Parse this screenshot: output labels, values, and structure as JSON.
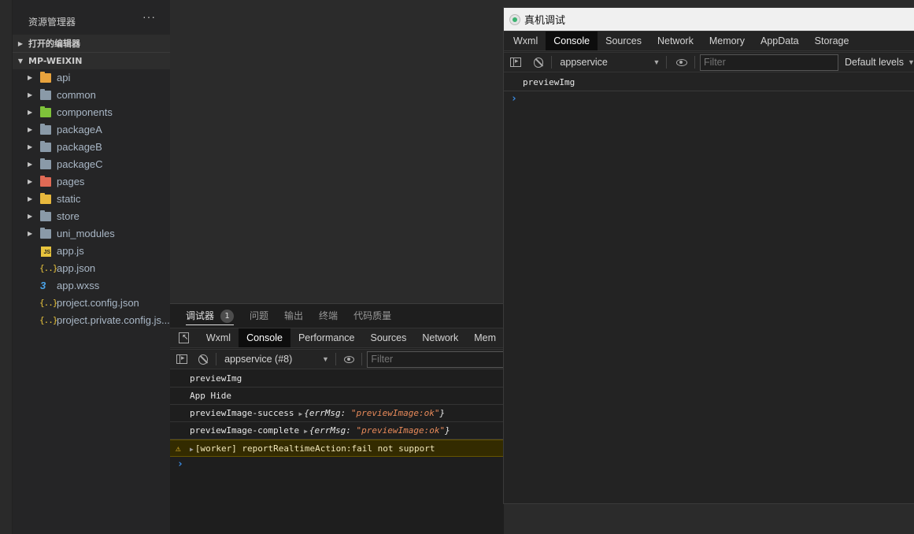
{
  "explorer": {
    "title": "资源管理器",
    "more": "···",
    "open_editors": "打开的编辑器",
    "project": "MP-WEIXIN",
    "items": [
      {
        "label": "api",
        "type": "folder",
        "icon": "folder-api-icon"
      },
      {
        "label": "common",
        "type": "folder",
        "icon": "folder-icon"
      },
      {
        "label": "components",
        "type": "folder",
        "icon": "folder-components-icon"
      },
      {
        "label": "packageA",
        "type": "folder",
        "icon": "folder-icon"
      },
      {
        "label": "packageB",
        "type": "folder",
        "icon": "folder-icon"
      },
      {
        "label": "packageC",
        "type": "folder",
        "icon": "folder-icon"
      },
      {
        "label": "pages",
        "type": "folder",
        "icon": "folder-pages-icon"
      },
      {
        "label": "static",
        "type": "folder",
        "icon": "folder-static-icon"
      },
      {
        "label": "store",
        "type": "folder",
        "icon": "folder-icon"
      },
      {
        "label": "uni_modules",
        "type": "folder",
        "icon": "folder-icon"
      },
      {
        "label": "app.js",
        "type": "file",
        "icon": "js-file-icon"
      },
      {
        "label": "app.json",
        "type": "file",
        "icon": "json-file-icon"
      },
      {
        "label": "app.wxss",
        "type": "file",
        "icon": "css-file-icon"
      },
      {
        "label": "project.config.json",
        "type": "file",
        "icon": "json-file-icon"
      },
      {
        "label": "project.private.config.js...",
        "type": "file",
        "icon": "json-file-icon"
      }
    ],
    "json_glyph": "{..}",
    "js_glyph": "JS",
    "css_glyph": "3"
  },
  "panel": {
    "tabs": [
      {
        "label": "调试器",
        "active": true
      },
      {
        "label": "问题"
      },
      {
        "label": "输出"
      },
      {
        "label": "终端"
      },
      {
        "label": "代码质量"
      }
    ],
    "badge": "1",
    "devtools_tabs": [
      "Wxml",
      "Console",
      "Performance",
      "Sources",
      "Network",
      "Mem"
    ],
    "active_tab": "Console",
    "context": "appservice (#8)",
    "filter_placeholder": "Filter",
    "console": [
      {
        "text": "previewImg"
      },
      {
        "text": "App Hide"
      },
      {
        "text": "previewImage-success",
        "obj_open": "{errMsg: ",
        "str": "\"previewImage:ok\"",
        "obj_close": "}"
      },
      {
        "text": "previewImage-complete",
        "obj_open": "{errMsg: ",
        "str": "\"previewImage:ok\"",
        "obj_close": "}"
      },
      {
        "text": "[worker] reportRealtimeAction:fail not support",
        "level": "warning"
      }
    ],
    "prompt": "›"
  },
  "remote": {
    "title": "真机调试",
    "devtools_tabs": [
      "Wxml",
      "Console",
      "Sources",
      "Network",
      "Memory",
      "AppData",
      "Storage"
    ],
    "active_tab": "Console",
    "context": "appservice",
    "filter_placeholder": "Filter",
    "levels": "Default levels",
    "console": [
      {
        "text": "previewImg"
      }
    ],
    "prompt": "›"
  },
  "colors": {
    "accent_prompt": "#3a8ee6",
    "warning_bg": "#332b00",
    "string": "#e88a5a"
  }
}
